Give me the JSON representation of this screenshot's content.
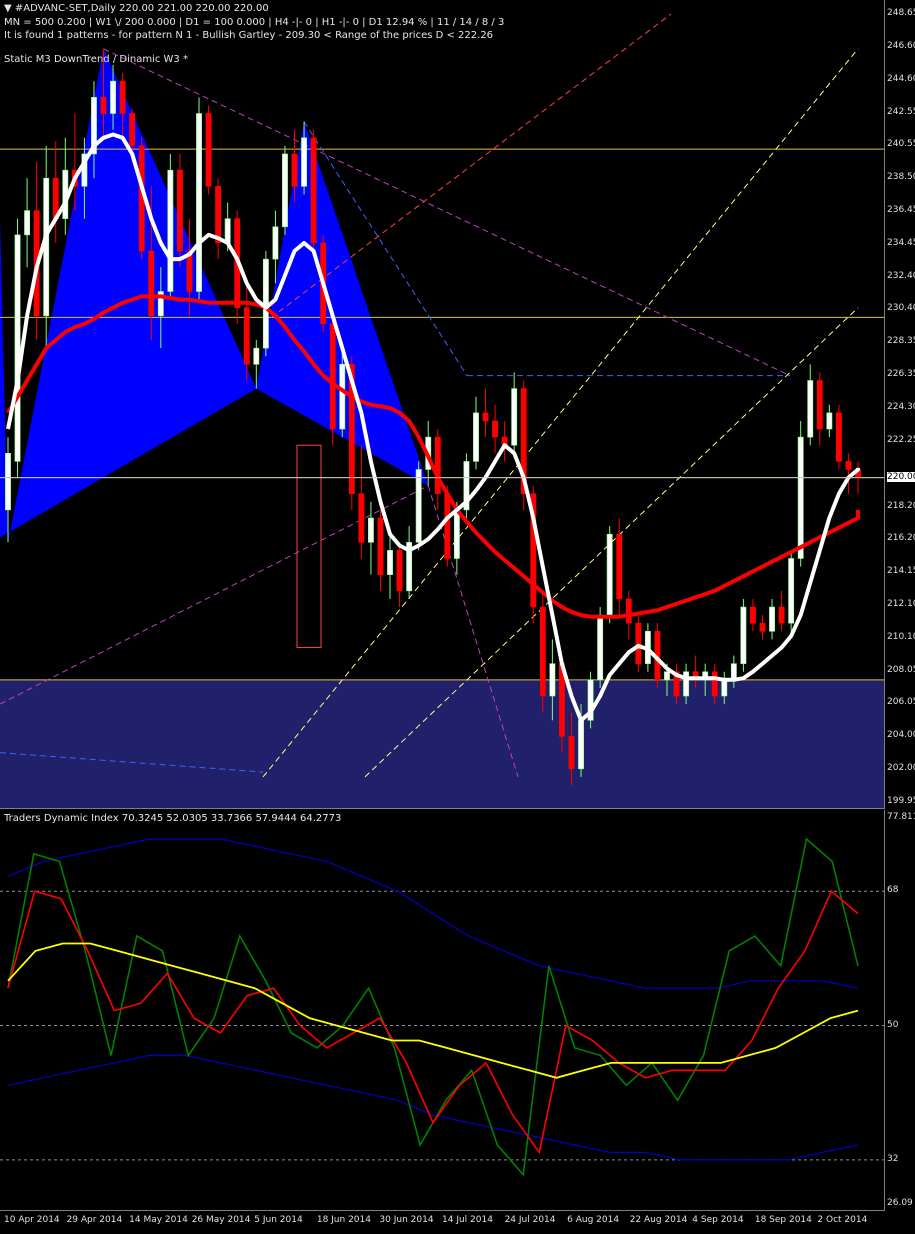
{
  "header": {
    "symbol_line": "#ADVANC-SET,Daily  220.00 221.00 220.00 220.00",
    "info_line": "MN = 500   0.200  |  W1 \\/ 200   0.000  |  D1 = 100   0.000  |  H4 -|- 0  |  H1 -|- 0  |  D1  12.94 %  |  11 / 14 / 8 / 3",
    "pattern_line": "It is found 1 patterns  -  for pattern N 1 - Bullish Gartley - 209.30 < Range of the prices D < 222.26",
    "status_line": "Static  M3   DownTrend  /  Dinamic  W3   *"
  },
  "indicator": {
    "title": "Traders Dynamic Index 70.3245 52.0305 33.7366 57.9444 64.2773"
  },
  "colors": {
    "background": "#000000",
    "bull_candle": "#ffffff",
    "bear_candle": "#ff0000",
    "fast_ma": "#ffffff",
    "slow_ma": "#ff0000",
    "pattern_fill": "#0000ff",
    "zone_fill": "#20206b",
    "fib_level": "#e0c040",
    "tdi_band": "#0000c8",
    "tdi_rsi": "#008000",
    "tdi_signal": "#ff0000",
    "tdi_base": "#ffff00"
  },
  "chart_data": [
    {
      "type": "candlestick",
      "title": "#ADVANC-SET,Daily",
      "x_ticks": [
        "10 Apr 2014",
        "29 Apr 2014",
        "14 May 2014",
        "26 May 2014",
        "5 Jun 2014",
        "18 Jun 2014",
        "30 Jun 2014",
        "14 Jul 2014",
        "24 Jul 2014",
        "6 Aug 2014",
        "22 Aug 2014",
        "4 Sep 2014",
        "18 Sep 2014",
        "2 Oct 2014"
      ],
      "y_ticks": [
        248.65,
        246.6,
        244.6,
        242.55,
        240.55,
        238.5,
        236.45,
        234.45,
        232.4,
        230.4,
        228.35,
        226.35,
        224.3,
        222.25,
        220.0,
        218.2,
        216.2,
        214.15,
        212.1,
        210.1,
        208.05,
        206.05,
        204.0,
        202.0,
        199.95
      ],
      "ylim": [
        199.95,
        248.65
      ],
      "current_price": 220.0,
      "grid": false,
      "candles": [
        {
          "o": 218.0,
          "h": 222.5,
          "l": 216.0,
          "c": 221.5
        },
        {
          "o": 221.0,
          "h": 236.0,
          "l": 220.0,
          "c": 235.0
        },
        {
          "o": 235.0,
          "h": 238.5,
          "l": 233.0,
          "c": 236.5
        },
        {
          "o": 236.5,
          "h": 239.5,
          "l": 228.5,
          "c": 230.0
        },
        {
          "o": 230.0,
          "h": 240.5,
          "l": 228.0,
          "c": 238.5
        },
        {
          "o": 238.5,
          "h": 240.8,
          "l": 234.5,
          "c": 236.0
        },
        {
          "o": 236.0,
          "h": 241.0,
          "l": 235.0,
          "c": 239.0
        },
        {
          "o": 239.0,
          "h": 242.5,
          "l": 236.5,
          "c": 238.0
        },
        {
          "o": 238.0,
          "h": 241.0,
          "l": 236.0,
          "c": 240.0
        },
        {
          "o": 240.0,
          "h": 244.5,
          "l": 238.5,
          "c": 243.5
        },
        {
          "o": 243.5,
          "h": 246.5,
          "l": 241.0,
          "c": 242.5
        },
        {
          "o": 242.5,
          "h": 245.5,
          "l": 241.5,
          "c": 244.5
        },
        {
          "o": 244.5,
          "h": 245.0,
          "l": 241.0,
          "c": 242.5
        },
        {
          "o": 242.5,
          "h": 242.8,
          "l": 239.5,
          "c": 240.5
        },
        {
          "o": 240.5,
          "h": 241.0,
          "l": 233.5,
          "c": 234.0
        },
        {
          "o": 234.0,
          "h": 238.0,
          "l": 228.5,
          "c": 230.0
        },
        {
          "o": 230.0,
          "h": 233.0,
          "l": 228.0,
          "c": 231.5
        },
        {
          "o": 231.5,
          "h": 240.0,
          "l": 231.0,
          "c": 239.0
        },
        {
          "o": 239.0,
          "h": 240.0,
          "l": 233.0,
          "c": 234.0
        },
        {
          "o": 234.0,
          "h": 236.0,
          "l": 230.0,
          "c": 231.5
        },
        {
          "o": 231.5,
          "h": 243.5,
          "l": 231.0,
          "c": 242.5
        },
        {
          "o": 242.5,
          "h": 243.0,
          "l": 237.5,
          "c": 238.0
        },
        {
          "o": 238.0,
          "h": 238.5,
          "l": 233.5,
          "c": 234.5
        },
        {
          "o": 234.5,
          "h": 237.0,
          "l": 234.0,
          "c": 236.0
        },
        {
          "o": 236.0,
          "h": 236.5,
          "l": 229.5,
          "c": 230.5
        },
        {
          "o": 230.5,
          "h": 232.0,
          "l": 226.0,
          "c": 227.0
        },
        {
          "o": 227.0,
          "h": 228.5,
          "l": 225.5,
          "c": 228.0
        },
        {
          "o": 228.0,
          "h": 234.0,
          "l": 227.5,
          "c": 233.5
        },
        {
          "o": 233.5,
          "h": 236.5,
          "l": 232.0,
          "c": 235.5
        },
        {
          "o": 235.5,
          "h": 240.5,
          "l": 235.0,
          "c": 240.0
        },
        {
          "o": 240.0,
          "h": 241.5,
          "l": 237.0,
          "c": 238.0
        },
        {
          "o": 238.0,
          "h": 242.0,
          "l": 237.5,
          "c": 241.0
        },
        {
          "o": 241.0,
          "h": 241.5,
          "l": 234.0,
          "c": 234.5
        },
        {
          "o": 234.5,
          "h": 235.0,
          "l": 229.0,
          "c": 229.5
        },
        {
          "o": 229.5,
          "h": 230.0,
          "l": 222.0,
          "c": 223.0
        },
        {
          "o": 223.0,
          "h": 228.0,
          "l": 222.5,
          "c": 227.0
        },
        {
          "o": 227.0,
          "h": 227.5,
          "l": 218.0,
          "c": 219.0
        },
        {
          "o": 219.0,
          "h": 222.0,
          "l": 215.0,
          "c": 216.0
        },
        {
          "o": 216.0,
          "h": 218.5,
          "l": 214.0,
          "c": 217.5
        },
        {
          "o": 217.5,
          "h": 218.0,
          "l": 213.0,
          "c": 214.0
        },
        {
          "o": 214.0,
          "h": 216.5,
          "l": 212.5,
          "c": 215.5
        },
        {
          "o": 215.5,
          "h": 216.0,
          "l": 212.0,
          "c": 213.0
        },
        {
          "o": 213.0,
          "h": 217.0,
          "l": 212.5,
          "c": 216.0
        },
        {
          "o": 216.0,
          "h": 221.0,
          "l": 215.5,
          "c": 220.5
        },
        {
          "o": 220.5,
          "h": 223.5,
          "l": 219.5,
          "c": 222.5
        },
        {
          "o": 222.5,
          "h": 223.0,
          "l": 218.0,
          "c": 219.0
        },
        {
          "o": 219.0,
          "h": 219.5,
          "l": 214.5,
          "c": 215.0
        },
        {
          "o": 215.0,
          "h": 218.5,
          "l": 214.0,
          "c": 218.0
        },
        {
          "o": 218.0,
          "h": 221.5,
          "l": 217.5,
          "c": 221.0
        },
        {
          "o": 221.0,
          "h": 225.0,
          "l": 220.5,
          "c": 224.0
        },
        {
          "o": 224.0,
          "h": 225.5,
          "l": 222.5,
          "c": 223.5
        },
        {
          "o": 223.5,
          "h": 224.5,
          "l": 221.5,
          "c": 222.5
        },
        {
          "o": 222.5,
          "h": 223.5,
          "l": 221.0,
          "c": 222.0
        },
        {
          "o": 222.0,
          "h": 226.5,
          "l": 221.5,
          "c": 225.5
        },
        {
          "o": 225.5,
          "h": 226.0,
          "l": 218.0,
          "c": 219.0
        },
        {
          "o": 219.0,
          "h": 219.5,
          "l": 211.0,
          "c": 212.0
        },
        {
          "o": 212.0,
          "h": 213.0,
          "l": 205.5,
          "c": 206.5
        },
        {
          "o": 206.5,
          "h": 210.0,
          "l": 205.0,
          "c": 208.5
        },
        {
          "o": 208.5,
          "h": 209.0,
          "l": 203.0,
          "c": 204.0
        },
        {
          "o": 204.0,
          "h": 205.5,
          "l": 201.0,
          "c": 202.0
        },
        {
          "o": 202.0,
          "h": 206.0,
          "l": 201.5,
          "c": 205.0
        },
        {
          "o": 205.0,
          "h": 208.0,
          "l": 204.5,
          "c": 207.5
        },
        {
          "o": 207.5,
          "h": 212.0,
          "l": 207.0,
          "c": 211.5
        },
        {
          "o": 211.5,
          "h": 217.0,
          "l": 211.0,
          "c": 216.5
        },
        {
          "o": 216.5,
          "h": 217.5,
          "l": 211.5,
          "c": 212.5
        },
        {
          "o": 212.5,
          "h": 213.0,
          "l": 210.0,
          "c": 211.0
        },
        {
          "o": 211.0,
          "h": 211.5,
          "l": 208.0,
          "c": 208.5
        },
        {
          "o": 208.5,
          "h": 211.0,
          "l": 208.0,
          "c": 210.5
        },
        {
          "o": 210.5,
          "h": 211.0,
          "l": 207.0,
          "c": 207.5
        },
        {
          "o": 207.5,
          "h": 208.5,
          "l": 206.5,
          "c": 208.0
        },
        {
          "o": 208.0,
          "h": 208.5,
          "l": 206.0,
          "c": 206.5
        },
        {
          "o": 206.5,
          "h": 208.5,
          "l": 206.0,
          "c": 208.0
        },
        {
          "o": 208.0,
          "h": 209.0,
          "l": 207.0,
          "c": 207.5
        },
        {
          "o": 207.5,
          "h": 208.5,
          "l": 206.5,
          "c": 208.0
        },
        {
          "o": 208.0,
          "h": 208.5,
          "l": 206.0,
          "c": 206.5
        },
        {
          "o": 206.5,
          "h": 208.0,
          "l": 206.0,
          "c": 207.5
        },
        {
          "o": 207.5,
          "h": 209.0,
          "l": 207.0,
          "c": 208.5
        },
        {
          "o": 208.5,
          "h": 212.5,
          "l": 208.0,
          "c": 212.0
        },
        {
          "o": 212.0,
          "h": 212.5,
          "l": 210.5,
          "c": 211.0
        },
        {
          "o": 211.0,
          "h": 211.5,
          "l": 210.0,
          "c": 210.5
        },
        {
          "o": 210.5,
          "h": 212.5,
          "l": 210.0,
          "c": 212.0
        },
        {
          "o": 212.0,
          "h": 213.0,
          "l": 210.5,
          "c": 211.0
        },
        {
          "o": 211.0,
          "h": 215.5,
          "l": 210.5,
          "c": 215.0
        },
        {
          "o": 215.0,
          "h": 223.5,
          "l": 214.5,
          "c": 222.5
        },
        {
          "o": 222.5,
          "h": 227.0,
          "l": 222.0,
          "c": 226.0
        },
        {
          "o": 226.0,
          "h": 226.5,
          "l": 222.0,
          "c": 223.0
        },
        {
          "o": 223.0,
          "h": 224.5,
          "l": 222.5,
          "c": 224.0
        },
        {
          "o": 224.0,
          "h": 224.5,
          "l": 220.5,
          "c": 221.0
        },
        {
          "o": 221.0,
          "h": 221.5,
          "l": 219.0,
          "c": 220.5
        },
        {
          "o": 220.5,
          "h": 221.0,
          "l": 219.0,
          "c": 220.0
        }
      ],
      "fast_ma": [
        223,
        226,
        230,
        233,
        235,
        236,
        237,
        238.5,
        239.5,
        240.5,
        241,
        241.2,
        241,
        240,
        238,
        236,
        234.5,
        233.5,
        233.5,
        233.8,
        234.5,
        235,
        234.8,
        234.5,
        233.5,
        232,
        231,
        230.5,
        231,
        232.5,
        234,
        234.5,
        234,
        232,
        230,
        228,
        226,
        224,
        221,
        218.5,
        216.5,
        215.8,
        215.5,
        215.8,
        216.2,
        216.8,
        217.5,
        218,
        218.5,
        219.2,
        220,
        221,
        222,
        221.5,
        220,
        217.5,
        214.5,
        211.5,
        208.5,
        206.5,
        205,
        205.5,
        206.5,
        207.8,
        208.5,
        209.2,
        209.6,
        209.4,
        208.8,
        208.2,
        207.8,
        207.6,
        207.6,
        207.6,
        207.6,
        207.5,
        207.5,
        207.6,
        208,
        208.5,
        209,
        209.5,
        210.2,
        211.5,
        213.5,
        215.5,
        217.5,
        219,
        220,
        220.5,
        220.6,
        220.6
      ],
      "slow_ma": [
        224,
        225,
        226,
        227,
        228,
        228.5,
        229,
        229.3,
        229.5,
        229.8,
        230.2,
        230.5,
        230.8,
        231,
        231.2,
        231.2,
        231.2,
        231.1,
        231.0,
        231.0,
        230.9,
        230.8,
        230.8,
        230.8,
        230.8,
        230.8,
        230.7,
        230.5,
        230.0,
        229.3,
        228.5,
        227.8,
        227.0,
        226.3,
        225.8,
        225.4,
        225.0,
        224.7,
        224.5,
        224.4,
        224.3,
        224.0,
        223.5,
        222.5,
        221.3,
        220.0,
        219.0,
        218.0,
        217.3,
        216.6,
        216.0,
        215.4,
        214.9,
        214.4,
        213.9,
        213.4,
        212.9,
        212.4,
        212.0,
        211.7,
        211.5,
        211.4,
        211.4,
        211.4,
        211.4,
        211.5,
        211.6,
        211.7,
        211.8,
        212.0,
        212.2,
        212.4,
        212.6,
        212.8,
        213.0,
        213.3,
        213.6,
        213.9,
        214.2,
        214.5,
        214.8,
        215.1,
        215.4,
        215.7,
        216.0,
        216.3,
        216.6,
        216.9,
        217.2,
        217.5,
        217.8,
        218.0
      ]
    },
    {
      "type": "line",
      "title": "Traders Dynamic Index 70.3245 52.0305 33.7366 57.9444 64.2773",
      "y_ticks": [
        77.8116,
        68,
        50,
        32,
        26.09
      ],
      "ylim": [
        26.09,
        77.8116
      ],
      "levels": [
        68,
        50,
        32
      ],
      "series": [
        {
          "values": [
            70,
            72,
            73,
            74,
            75,
            75,
            75,
            74,
            73,
            72,
            70,
            68,
            65,
            62,
            60,
            58,
            57,
            56,
            55,
            55,
            55,
            56,
            56,
            56,
            55
          ]
        },
        {
          "values": [
            42,
            43,
            44,
            45,
            46,
            46,
            45,
            44,
            43,
            42,
            41,
            40,
            38,
            37,
            36,
            35,
            34,
            33,
            33,
            32,
            32,
            32,
            32,
            33,
            34
          ]
        },
        {
          "values": [
            55,
            73,
            72,
            60,
            46,
            62,
            60,
            46,
            51,
            62,
            56,
            49,
            47,
            50,
            55,
            47,
            34,
            40,
            44,
            34,
            30,
            58,
            47,
            46,
            42,
            45,
            40,
            46,
            60,
            62,
            58,
            75,
            72,
            58
          ]
        },
        {
          "values": [
            55,
            68,
            67,
            60,
            52,
            53,
            57,
            51,
            49,
            54,
            55,
            50,
            47,
            49,
            51,
            45,
            37,
            42,
            45,
            38,
            33,
            50,
            48,
            45,
            43,
            44,
            44,
            44,
            48,
            55,
            60,
            68,
            65
          ]
        },
        {
          "values": [
            56,
            60,
            61,
            61,
            60,
            59,
            58,
            57,
            56,
            55,
            53,
            51,
            50,
            49,
            48,
            48,
            47,
            46,
            45,
            44,
            43,
            44,
            45,
            45,
            45,
            45,
            45,
            46,
            47,
            49,
            51,
            52
          ]
        }
      ]
    }
  ]
}
